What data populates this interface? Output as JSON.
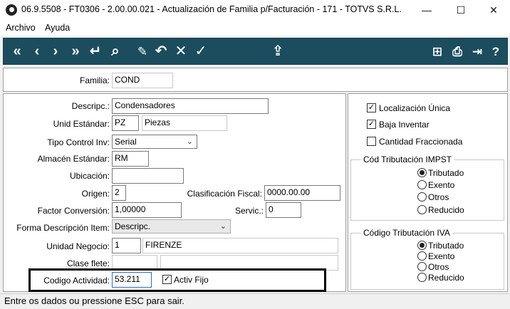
{
  "window": {
    "title": "06.9.5508 - FT0306 - 2.00.00.021 - Actualización de Familia p/Facturación - 171 - TOTVS S.R.L.",
    "minimize_glyph": "—",
    "maximize_glyph": "☐",
    "close_glyph": "✕"
  },
  "menu": [
    "Archivo",
    "Ayuda"
  ],
  "toolbar": {
    "first": "«",
    "prev": "‹",
    "next": "›",
    "last": "»",
    "return": "↵",
    "search": "⌕",
    "edit": "✎",
    "undo": "↶",
    "cancel": "✕",
    "confirm": "✓",
    "upload": "⇪",
    "tree": "⊞",
    "print": "⎙",
    "exit": "⇥",
    "help": "?"
  },
  "header": {
    "familia_label": "Familia:",
    "familia_value": "COND"
  },
  "form": {
    "descripc_label": "Descripc.:",
    "descripc_value": "Condensadores",
    "unid_label": "Unid Estándar:",
    "unid_value": "PZ",
    "unid_desc": "Piezas",
    "tipo_control_label": "Tipo Control Inv:",
    "tipo_control_value": "Serial",
    "almacen_label": "Almacén Estándar:",
    "almacen_value": "RM",
    "ubicacion_label": "Ubicación:",
    "ubicacion_value": "",
    "origen_label": "Origen:",
    "origen_value": "2",
    "clasif_label": "Clasificación Fiscal:",
    "clasif_value": "0000.00.00",
    "factor_label": "Factor Conversión:",
    "factor_value": "1,00000",
    "servic_label": "Servic.:",
    "servic_value": "0",
    "forma_label": "Forma Descripción Item:",
    "forma_value": "Descripc.",
    "unidad_neg_label": "Unidad Negocio:",
    "unidad_neg_value": "1",
    "unidad_neg_desc": "FIRENZE",
    "clase_flete_label": "Clase flete:",
    "clase_flete_value": "",
    "clase_flete_desc": "",
    "codigo_act_label": "Codigo Actividad:",
    "codigo_act_value": "53.211",
    "activ_fijo_label": "Activ Fijo",
    "activ_fijo_checked": true
  },
  "options": {
    "localizacion_label": "Localización Única",
    "localizacion_checked": true,
    "baja_label": "Baja Inventar",
    "baja_checked": true,
    "cantidad_label": "Cantidad Fraccionada",
    "cantidad_checked": false
  },
  "impst": {
    "title": "Cód Tributación IMPST",
    "options": [
      "Tributado",
      "Exento",
      "Otros",
      "Reducido"
    ],
    "selected": "Tributado"
  },
  "iva": {
    "title": "Código Tributación IVA",
    "options": [
      "Tributado",
      "Exento",
      "Otros",
      "Reducido"
    ],
    "selected": "Tributado"
  },
  "status": "Entre os dados ou pressione ESC para sair.",
  "check_mark": "✓",
  "chevron": "⌄",
  "colors": {
    "toolbar": "#1b4d5e",
    "highlight_box": "#000000"
  }
}
